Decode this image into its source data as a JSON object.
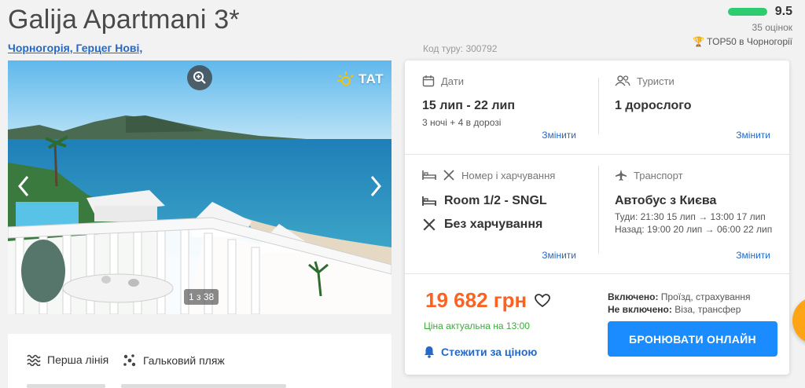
{
  "hotel": {
    "title": "Galija Apartmani 3*",
    "location": "Чорногорія, Герцег Нові,",
    "tour_code": "Код туру: 300792"
  },
  "rating": {
    "score": "9.5",
    "count": "35 оцінок",
    "top": "TOP50 в Чорногорії",
    "bar_color": "#2ecc71"
  },
  "gallery": {
    "logo": "TAT",
    "counter": "1 з 38",
    "icons": [
      "zoom-icon",
      "chevron-left-icon",
      "chevron-right-icon",
      "sun-icon"
    ]
  },
  "features": [
    {
      "icon": "waves-icon",
      "label": "Перша лінія"
    },
    {
      "icon": "pebbles-icon",
      "label": "Гальковий пляж"
    }
  ],
  "dates": {
    "header": "Дати",
    "value": "15 лип - 22 лип",
    "detail": "3 ночі + 4 в дорозі",
    "change": "Змінити"
  },
  "tourists": {
    "header": "Туристи",
    "value": "1 дорослого",
    "change": "Змінити"
  },
  "room": {
    "header": "Номер і харчування",
    "room_value": "Room 1/2 - SNGL",
    "meal_value": "Без харчування",
    "change": "Змінити"
  },
  "transport": {
    "header": "Транспорт",
    "value": "Автобус з Києва",
    "there": "Туди: 21:30 15 лип → 13:00 17 лип",
    "back": "Назад: 19:00 20 лип → 06:00 22 лип",
    "change": "Змінити"
  },
  "pricing": {
    "price": "19 682 грн",
    "note": "Ціна актуальна на 13:00",
    "watch": "Стежити за ціною",
    "included_label": "Включено:",
    "included_value": "Проїзд, страхування",
    "excluded_label": "Не включено:",
    "excluded_value": "Віза, трансфер",
    "book": "БРОНЮВАТИ ОНЛАЙН",
    "price_color": "#ff6121",
    "button_color": "#1a8cff"
  }
}
